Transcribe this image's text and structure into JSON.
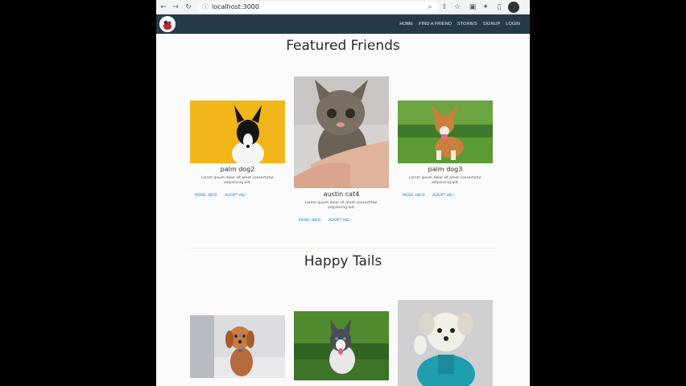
{
  "browser": {
    "url": "localhost:3000",
    "back_icon": "arrow-left-icon",
    "forward_icon": "arrow-right-icon",
    "reload_icon": "reload-icon"
  },
  "navbar": {
    "links": [
      "HOME",
      "FIND A FRIEND",
      "STORIES",
      "SIGNUP",
      "LOGIN"
    ]
  },
  "featured": {
    "title": "Featured Friends",
    "cards": [
      {
        "name": "palm dog2",
        "desc": "Lorem ipsum dolor sit amet consectetur adipisicing elit.",
        "more": "MORE INFO",
        "adopt": "ADOPT ME!"
      },
      {
        "name": "austin cat4",
        "desc": "Lorem ipsum dolor sit amet consectetur adipisicing elit.",
        "more": "MORE INFO",
        "adopt": "ADOPT ME!"
      },
      {
        "name": "palm dog3",
        "desc": "Lorem ipsum dolor sit amet consectetur adipisicing elit.",
        "more": "MORE INFO",
        "adopt": "ADOPT ME!"
      }
    ]
  },
  "happy_tails": {
    "title": "Happy Tails"
  },
  "colors": {
    "navbar": "#263b47",
    "link": "#1f6fd1"
  }
}
